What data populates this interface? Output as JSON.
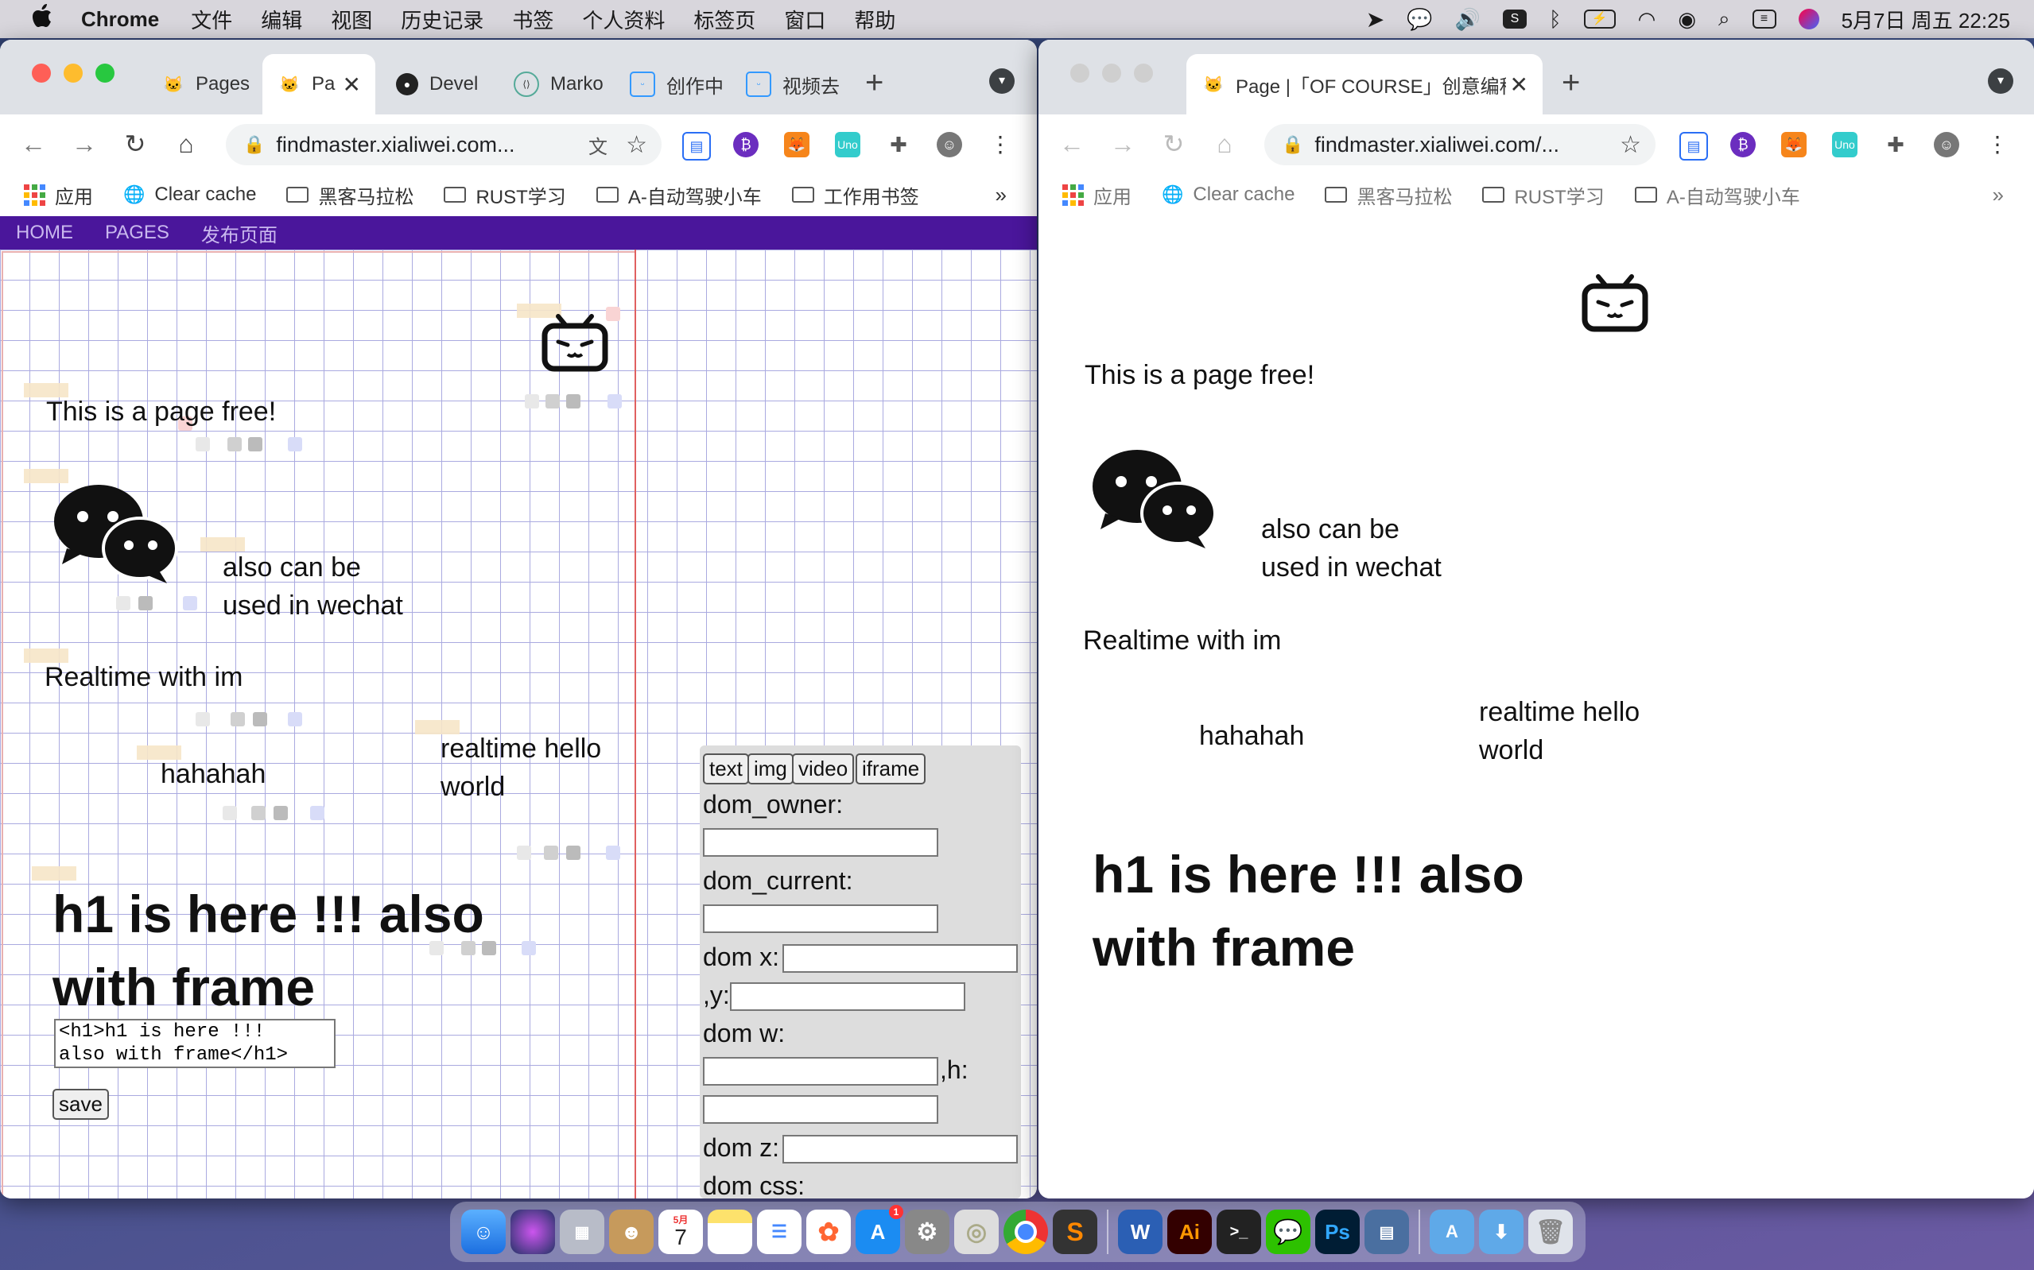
{
  "menubar": {
    "apple": "",
    "app": "Chrome",
    "items": [
      "文件",
      "编辑",
      "视图",
      "历史记录",
      "书签",
      "个人资料",
      "标签页",
      "窗口",
      "帮助"
    ],
    "datetime": "5月7日 周五  22:25"
  },
  "left_window": {
    "tabs": [
      {
        "label": "Pages",
        "icon": "cat-icon"
      },
      {
        "label": "Pa",
        "icon": "cat-icon"
      },
      {
        "label": "Devel",
        "icon": "github-icon"
      },
      {
        "label": "Marko",
        "icon": "markdown-icon"
      },
      {
        "label": "创作中",
        "icon": "bilibili-icon"
      },
      {
        "label": "视频去",
        "icon": "bilibili-icon"
      }
    ],
    "close": "✕",
    "new_tab": "+",
    "url": "findmaster.xialiwei.com...",
    "bookmarks": [
      "应用",
      "Clear cache",
      "黑客马拉松",
      "RUST学习",
      "A-自动驾驶小车",
      "工作用书签"
    ],
    "more": "»",
    "site_nav": [
      "HOME",
      "PAGES",
      "发布页面"
    ],
    "text1": "This  is a page free!",
    "text2a": "also  can be",
    "text2b": "used in wechat",
    "text3": "Realtime with im",
    "text4": "hahahah",
    "text5a": "realtime hello",
    "text5b": "world",
    "h1a": "h1 is here !!! also",
    "h1b": "with frame",
    "source": "<h1>h1 is here !!!\nalso with frame</h1>",
    "save": "save",
    "panel": {
      "buttons": [
        "text",
        "img",
        "video",
        "iframe"
      ],
      "dom_owner": "dom_owner:",
      "dom_current": "dom_current:",
      "dom_x": "dom x:",
      "dom_y": ",y:",
      "dom_w": "dom w:",
      "dom_h": ",h:",
      "dom_z": "dom z:",
      "dom_css": "dom css:"
    }
  },
  "right_window": {
    "tab": "Page |「OF COURSE」创意编程",
    "close": "✕",
    "new_tab": "+",
    "url": "findmaster.xialiwei.com/...",
    "bookmarks": [
      "应用",
      "Clear cache",
      "黑客马拉松",
      "RUST学习",
      "A-自动驾驶小车"
    ],
    "more": "»",
    "text1": "This  is a page free!",
    "text2a": "also  can be",
    "text2b": "used in wechat",
    "text3": "Realtime with im",
    "text4": "hahahah",
    "text5a": "realtime hello",
    "text5b": "world",
    "h1a": "h1 is here !!! also",
    "h1b": "with frame"
  },
  "dock": {
    "calendar_month": "5月",
    "calendar_day": "7",
    "appstore_badge": "1",
    "word": "W",
    "illustrator": "Ai",
    "photoshop": "Ps"
  },
  "colors": {
    "site_nav_bg": "#4a169b",
    "tabstrip": "#dee1e6",
    "panel": "#dddddd"
  }
}
